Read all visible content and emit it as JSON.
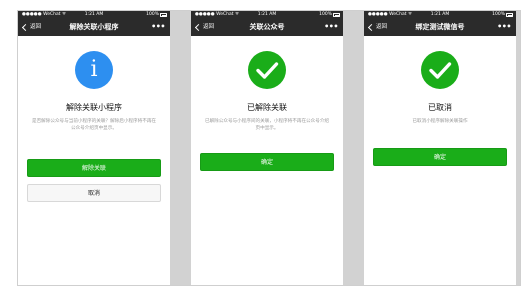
{
  "colors": {
    "nav_bg": "#2b2b2b",
    "primary_green": "#1aad19",
    "info_blue": "#2d8ff0",
    "divider_gray": "#d2d2d2"
  },
  "screens": [
    {
      "status": {
        "carrier": "●●●●● WeChat ᯤ",
        "time": "1:21 AM",
        "battery": "100%"
      },
      "nav": {
        "back": "返回",
        "title": "解除关联小程序",
        "more": "•••"
      },
      "icon": "info-icon",
      "icon_glyph": "i",
      "heading": "解除关联小程序",
      "description": "是否解除公众号与当前小程序的关联？解除后小程序将不再在公众号介绍页中显示。",
      "primary_button": "解除关联",
      "secondary_button": "取消"
    },
    {
      "status": {
        "carrier": "●●●●● WeChat ᯤ",
        "time": "1:21 AM",
        "battery": "100%"
      },
      "nav": {
        "back": "返回",
        "title": "关联公众号",
        "more": "•••"
      },
      "icon": "success-check-icon",
      "heading": "已解除关联",
      "description": "已解除公众号与小程序间的关联，小程序将不再在公众号介绍页中显示。",
      "primary_button": "确定"
    },
    {
      "status": {
        "carrier": "●●●●● WeChat ᯤ",
        "time": "1:21 AM",
        "battery": "100%"
      },
      "nav": {
        "back": "返回",
        "title": "绑定测试微信号",
        "more": "•••"
      },
      "icon": "success-check-icon",
      "heading": "已取消",
      "description": "已取消小程序解除关联操作",
      "primary_button": "确定"
    }
  ]
}
